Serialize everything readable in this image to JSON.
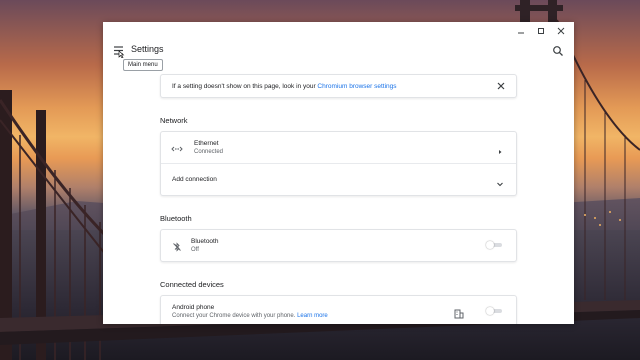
{
  "window": {
    "title": "Settings",
    "tooltip": "Main menu",
    "icons": {
      "menu": "menu-icon",
      "search": "search-icon",
      "minimize": "minimize-icon",
      "maximize": "maximize-icon",
      "close": "close-icon"
    }
  },
  "notice": {
    "text": "If a setting doesn't show on this page, look in your ",
    "link": "Chromium browser settings"
  },
  "network": {
    "section_title": "Network",
    "ethernet_label": "Ethernet",
    "ethernet_status": "Connected",
    "add_connection_label": "Add connection"
  },
  "bluetooth": {
    "section_title": "Bluetooth",
    "label": "Bluetooth",
    "status": "Off",
    "enabled": false
  },
  "connected_devices": {
    "section_title": "Connected devices",
    "android_label": "Android phone",
    "android_desc": "Connect your Chrome device with your phone. ",
    "learn_more": "Learn more",
    "enabled": false
  },
  "colors": {
    "accent": "#1a73e8",
    "text_primary": "#202124",
    "text_secondary": "#5f6368"
  }
}
